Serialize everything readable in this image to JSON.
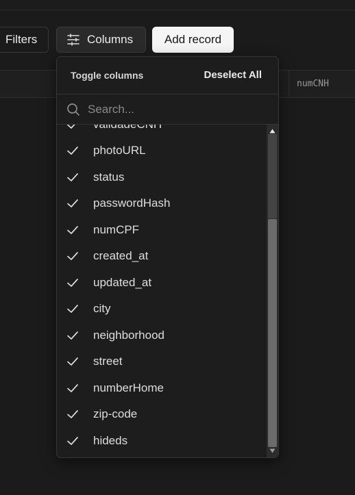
{
  "toolbar": {
    "filters_label": "Filters",
    "columns_label": "Columns",
    "add_record_label": "Add record"
  },
  "table": {
    "visible_column": "numCNH"
  },
  "dropdown": {
    "title": "Toggle columns",
    "deselect_all": "Deselect All",
    "search_placeholder": "Search...",
    "items": [
      {
        "label": "validadeCNH",
        "checked": true
      },
      {
        "label": "photoURL",
        "checked": true
      },
      {
        "label": "status",
        "checked": true
      },
      {
        "label": "passwordHash",
        "checked": true
      },
      {
        "label": "numCPF",
        "checked": true
      },
      {
        "label": "created_at",
        "checked": true
      },
      {
        "label": "updated_at",
        "checked": true
      },
      {
        "label": "city",
        "checked": true
      },
      {
        "label": "neighborhood",
        "checked": true
      },
      {
        "label": "street",
        "checked": true
      },
      {
        "label": "numberHome",
        "checked": true
      },
      {
        "label": "zip-code",
        "checked": true
      },
      {
        "label": "hideds",
        "checked": true
      }
    ]
  },
  "colors": {
    "background": "#1b1b1b",
    "panel": "#1d1d1d",
    "accent_button": "#f5f5f5",
    "scroll_thumb": "#6b6b6b"
  }
}
